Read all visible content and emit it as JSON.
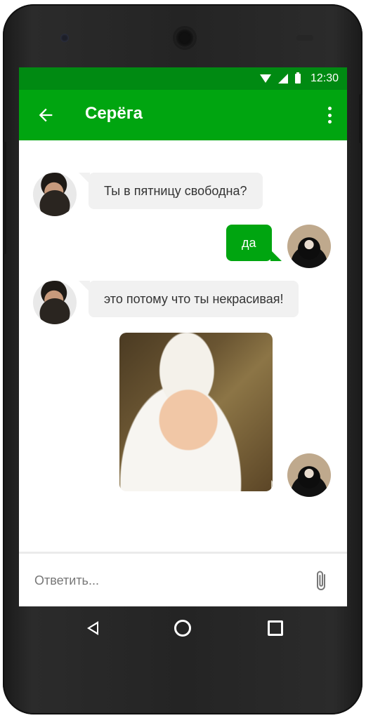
{
  "status_bar": {
    "time": "12:30"
  },
  "header": {
    "title": "Серёга"
  },
  "messages": [
    {
      "direction": "incoming",
      "text": "Ты в пятницу свободна?"
    },
    {
      "direction": "outgoing",
      "text": "да"
    },
    {
      "direction": "incoming",
      "text": "это потому что ты некрасивая!"
    },
    {
      "direction": "outgoing",
      "type": "sticker"
    }
  ],
  "composer": {
    "placeholder": "Ответить..."
  },
  "colors": {
    "status_bar": "#008a12",
    "app_bar": "#00a510",
    "outgoing_bubble": "#00a510",
    "incoming_bubble": "#f1f1f1"
  }
}
